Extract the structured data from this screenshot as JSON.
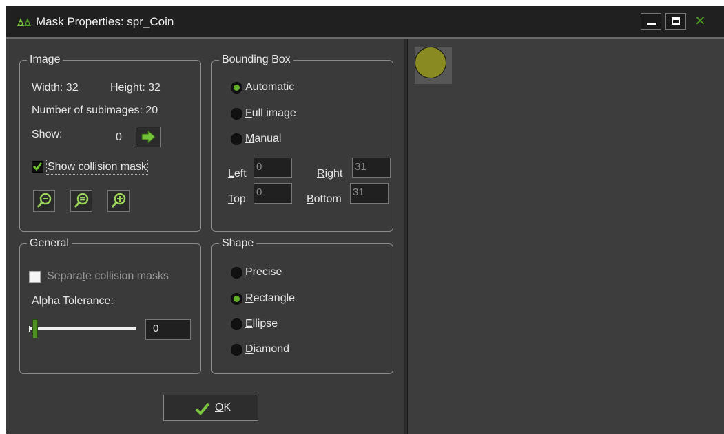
{
  "window": {
    "title": "Mask Properties: spr_Coin"
  },
  "colors": {
    "accent_green": "#63b02a",
    "coin": "#8a8a22",
    "background": "#3a3a3a",
    "titlebar": "#202020"
  },
  "image": {
    "legend": "Image",
    "width_label": "Width: 32",
    "height_label": "Height: 32",
    "subimages_label": "Number of subimages: 20",
    "show_label": "Show:",
    "show_value": "0",
    "show_collision_label": "Show collision mask",
    "show_collision_checked": true,
    "icons": [
      "zoom-out-icon",
      "zoom-reset-icon",
      "zoom-in-icon",
      "arrow-right-icon"
    ]
  },
  "bounding_box": {
    "legend": "Bounding Box",
    "automatic": {
      "pre": "A",
      "ul": "u",
      "post": "tomatic",
      "checked": true
    },
    "full_image": {
      "pre": "",
      "ul": "F",
      "post": "ull image",
      "checked": false
    },
    "manual": {
      "pre": "",
      "ul": "M",
      "post": "anual",
      "checked": false
    },
    "left": {
      "pre": "",
      "ul": "L",
      "post": "eft",
      "value": "0"
    },
    "right": {
      "pre": "",
      "ul": "R",
      "post": "ight",
      "value": "31"
    },
    "top": {
      "pre": "",
      "ul": "T",
      "post": "op",
      "value": "0"
    },
    "bottom": {
      "pre": "",
      "ul": "B",
      "post": "ottom",
      "value": "31"
    }
  },
  "general": {
    "legend": "General",
    "separate": {
      "pre": "Separa",
      "ul": "t",
      "post": "e collision masks",
      "checked": false
    },
    "alpha_label": "Alpha Tolerance:",
    "alpha_value": "0",
    "alpha_fraction": 0
  },
  "shape": {
    "legend": "Shape",
    "precise": {
      "pre": "",
      "ul": "P",
      "post": "recise",
      "checked": false
    },
    "rectangle": {
      "pre": "",
      "ul": "R",
      "post": "ectangle",
      "checked": true
    },
    "ellipse": {
      "pre": "",
      "ul": "E",
      "post": "llipse",
      "checked": false
    },
    "diamond": {
      "pre": "",
      "ul": "D",
      "post": "iamond",
      "checked": false
    }
  },
  "ok": {
    "pre": "",
    "ul": "O",
    "post": "K"
  }
}
